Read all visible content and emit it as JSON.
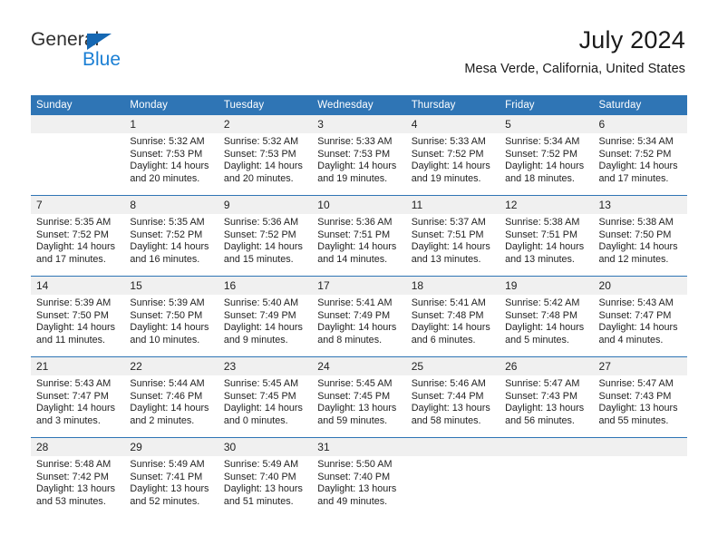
{
  "logo": {
    "word_one": "General",
    "word_two": "Blue",
    "triangle_color": "#1668b3",
    "blue_color": "#1b7fd4"
  },
  "header": {
    "title": "July 2024",
    "location": "Mesa Verde, California, United States"
  },
  "theme": {
    "header_blue": "#2f75b5",
    "day_band_gray": "#f0f0f0",
    "text": "#222222"
  },
  "weekday_headers": [
    "Sunday",
    "Monday",
    "Tuesday",
    "Wednesday",
    "Thursday",
    "Friday",
    "Saturday"
  ],
  "weeks": [
    [
      {
        "day": "",
        "empty": true,
        "sunrise": "",
        "sunset": "",
        "daylight": ""
      },
      {
        "day": "1",
        "empty": false,
        "sunrise": "Sunrise: 5:32 AM",
        "sunset": "Sunset: 7:53 PM",
        "daylight": "Daylight: 14 hours and 20 minutes."
      },
      {
        "day": "2",
        "empty": false,
        "sunrise": "Sunrise: 5:32 AM",
        "sunset": "Sunset: 7:53 PM",
        "daylight": "Daylight: 14 hours and 20 minutes."
      },
      {
        "day": "3",
        "empty": false,
        "sunrise": "Sunrise: 5:33 AM",
        "sunset": "Sunset: 7:53 PM",
        "daylight": "Daylight: 14 hours and 19 minutes."
      },
      {
        "day": "4",
        "empty": false,
        "sunrise": "Sunrise: 5:33 AM",
        "sunset": "Sunset: 7:52 PM",
        "daylight": "Daylight: 14 hours and 19 minutes."
      },
      {
        "day": "5",
        "empty": false,
        "sunrise": "Sunrise: 5:34 AM",
        "sunset": "Sunset: 7:52 PM",
        "daylight": "Daylight: 14 hours and 18 minutes."
      },
      {
        "day": "6",
        "empty": false,
        "sunrise": "Sunrise: 5:34 AM",
        "sunset": "Sunset: 7:52 PM",
        "daylight": "Daylight: 14 hours and 17 minutes."
      }
    ],
    [
      {
        "day": "7",
        "empty": false,
        "sunrise": "Sunrise: 5:35 AM",
        "sunset": "Sunset: 7:52 PM",
        "daylight": "Daylight: 14 hours and 17 minutes."
      },
      {
        "day": "8",
        "empty": false,
        "sunrise": "Sunrise: 5:35 AM",
        "sunset": "Sunset: 7:52 PM",
        "daylight": "Daylight: 14 hours and 16 minutes."
      },
      {
        "day": "9",
        "empty": false,
        "sunrise": "Sunrise: 5:36 AM",
        "sunset": "Sunset: 7:52 PM",
        "daylight": "Daylight: 14 hours and 15 minutes."
      },
      {
        "day": "10",
        "empty": false,
        "sunrise": "Sunrise: 5:36 AM",
        "sunset": "Sunset: 7:51 PM",
        "daylight": "Daylight: 14 hours and 14 minutes."
      },
      {
        "day": "11",
        "empty": false,
        "sunrise": "Sunrise: 5:37 AM",
        "sunset": "Sunset: 7:51 PM",
        "daylight": "Daylight: 14 hours and 13 minutes."
      },
      {
        "day": "12",
        "empty": false,
        "sunrise": "Sunrise: 5:38 AM",
        "sunset": "Sunset: 7:51 PM",
        "daylight": "Daylight: 14 hours and 13 minutes."
      },
      {
        "day": "13",
        "empty": false,
        "sunrise": "Sunrise: 5:38 AM",
        "sunset": "Sunset: 7:50 PM",
        "daylight": "Daylight: 14 hours and 12 minutes."
      }
    ],
    [
      {
        "day": "14",
        "empty": false,
        "sunrise": "Sunrise: 5:39 AM",
        "sunset": "Sunset: 7:50 PM",
        "daylight": "Daylight: 14 hours and 11 minutes."
      },
      {
        "day": "15",
        "empty": false,
        "sunrise": "Sunrise: 5:39 AM",
        "sunset": "Sunset: 7:50 PM",
        "daylight": "Daylight: 14 hours and 10 minutes."
      },
      {
        "day": "16",
        "empty": false,
        "sunrise": "Sunrise: 5:40 AM",
        "sunset": "Sunset: 7:49 PM",
        "daylight": "Daylight: 14 hours and 9 minutes."
      },
      {
        "day": "17",
        "empty": false,
        "sunrise": "Sunrise: 5:41 AM",
        "sunset": "Sunset: 7:49 PM",
        "daylight": "Daylight: 14 hours and 8 minutes."
      },
      {
        "day": "18",
        "empty": false,
        "sunrise": "Sunrise: 5:41 AM",
        "sunset": "Sunset: 7:48 PM",
        "daylight": "Daylight: 14 hours and 6 minutes."
      },
      {
        "day": "19",
        "empty": false,
        "sunrise": "Sunrise: 5:42 AM",
        "sunset": "Sunset: 7:48 PM",
        "daylight": "Daylight: 14 hours and 5 minutes."
      },
      {
        "day": "20",
        "empty": false,
        "sunrise": "Sunrise: 5:43 AM",
        "sunset": "Sunset: 7:47 PM",
        "daylight": "Daylight: 14 hours and 4 minutes."
      }
    ],
    [
      {
        "day": "21",
        "empty": false,
        "sunrise": "Sunrise: 5:43 AM",
        "sunset": "Sunset: 7:47 PM",
        "daylight": "Daylight: 14 hours and 3 minutes."
      },
      {
        "day": "22",
        "empty": false,
        "sunrise": "Sunrise: 5:44 AM",
        "sunset": "Sunset: 7:46 PM",
        "daylight": "Daylight: 14 hours and 2 minutes."
      },
      {
        "day": "23",
        "empty": false,
        "sunrise": "Sunrise: 5:45 AM",
        "sunset": "Sunset: 7:45 PM",
        "daylight": "Daylight: 14 hours and 0 minutes."
      },
      {
        "day": "24",
        "empty": false,
        "sunrise": "Sunrise: 5:45 AM",
        "sunset": "Sunset: 7:45 PM",
        "daylight": "Daylight: 13 hours and 59 minutes."
      },
      {
        "day": "25",
        "empty": false,
        "sunrise": "Sunrise: 5:46 AM",
        "sunset": "Sunset: 7:44 PM",
        "daylight": "Daylight: 13 hours and 58 minutes."
      },
      {
        "day": "26",
        "empty": false,
        "sunrise": "Sunrise: 5:47 AM",
        "sunset": "Sunset: 7:43 PM",
        "daylight": "Daylight: 13 hours and 56 minutes."
      },
      {
        "day": "27",
        "empty": false,
        "sunrise": "Sunrise: 5:47 AM",
        "sunset": "Sunset: 7:43 PM",
        "daylight": "Daylight: 13 hours and 55 minutes."
      }
    ],
    [
      {
        "day": "28",
        "empty": false,
        "sunrise": "Sunrise: 5:48 AM",
        "sunset": "Sunset: 7:42 PM",
        "daylight": "Daylight: 13 hours and 53 minutes."
      },
      {
        "day": "29",
        "empty": false,
        "sunrise": "Sunrise: 5:49 AM",
        "sunset": "Sunset: 7:41 PM",
        "daylight": "Daylight: 13 hours and 52 minutes."
      },
      {
        "day": "30",
        "empty": false,
        "sunrise": "Sunrise: 5:49 AM",
        "sunset": "Sunset: 7:40 PM",
        "daylight": "Daylight: 13 hours and 51 minutes."
      },
      {
        "day": "31",
        "empty": false,
        "sunrise": "Sunrise: 5:50 AM",
        "sunset": "Sunset: 7:40 PM",
        "daylight": "Daylight: 13 hours and 49 minutes."
      },
      {
        "day": "",
        "empty": true,
        "sunrise": "",
        "sunset": "",
        "daylight": ""
      },
      {
        "day": "",
        "empty": true,
        "sunrise": "",
        "sunset": "",
        "daylight": ""
      },
      {
        "day": "",
        "empty": true,
        "sunrise": "",
        "sunset": "",
        "daylight": ""
      }
    ]
  ]
}
